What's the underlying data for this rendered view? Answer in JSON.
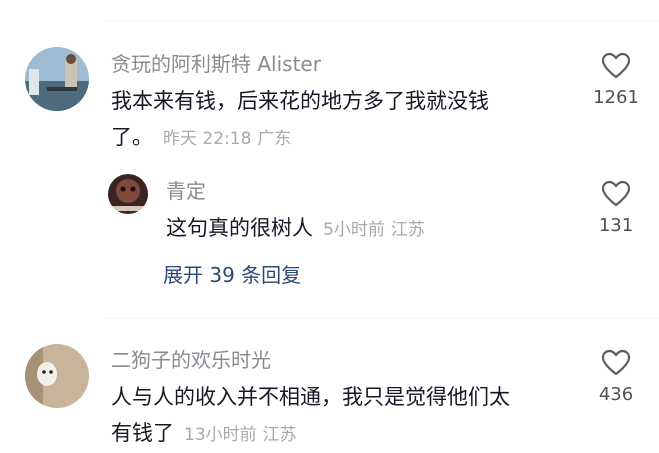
{
  "comments": [
    {
      "username": "贪玩的阿利斯特 Alister",
      "text_line1": "我本来有钱，后来花的地方多了我就没钱",
      "text_line2": "了。",
      "time": "昨天 22:18",
      "location": "广东",
      "likes": "1261",
      "reply": {
        "username": "青定",
        "text": "这句真的很树人",
        "time": "5小时前",
        "location": "江苏",
        "likes": "131"
      },
      "expand_label": "展开 39 条回复"
    },
    {
      "username": "二狗子的欢乐时光",
      "text_line1": "人与人的收入并不相通，我只是觉得他们太",
      "text_line2": "有钱了",
      "time": "13小时前",
      "location": "江苏",
      "likes": "436"
    }
  ],
  "icons": {
    "like": "heart-outline-icon"
  },
  "colors": {
    "username": "#8a8b91",
    "meta": "#a8a9ae",
    "expand": "#2d4a72"
  }
}
